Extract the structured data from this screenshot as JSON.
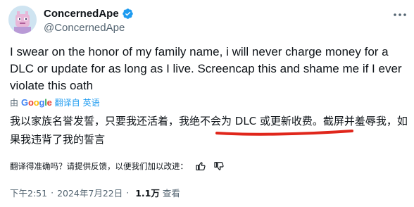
{
  "author": {
    "display_name": "ConcernedApe",
    "handle": "@ConcernedApe"
  },
  "tweet": {
    "text": "I swear on the honor of my family name, i will never charge money for a DLC or update for as long as I live. Screencap this and shame me if I ever violate this oath"
  },
  "translation_bar": {
    "by_label": "由",
    "google": [
      "G",
      "o",
      "o",
      "g",
      "l",
      "e"
    ],
    "translated_from": "翻译自",
    "language": "英语"
  },
  "translated": {
    "text": "我以家族名誉发誓，只要我还活着，我绝不会为 DLC 或更新收费。截屏并羞辱我，如果我违背了我的誓言"
  },
  "rate": {
    "question": "翻译得准确吗？请提供反馈，以便我们加以改进："
  },
  "meta": {
    "time": "下午2:51",
    "date": "2024年7月22日",
    "views": "1.1万",
    "views_label": "查看"
  },
  "colors": {
    "accent": "#1d9bf0",
    "underline": "#e0261b",
    "muted": "#536471"
  }
}
